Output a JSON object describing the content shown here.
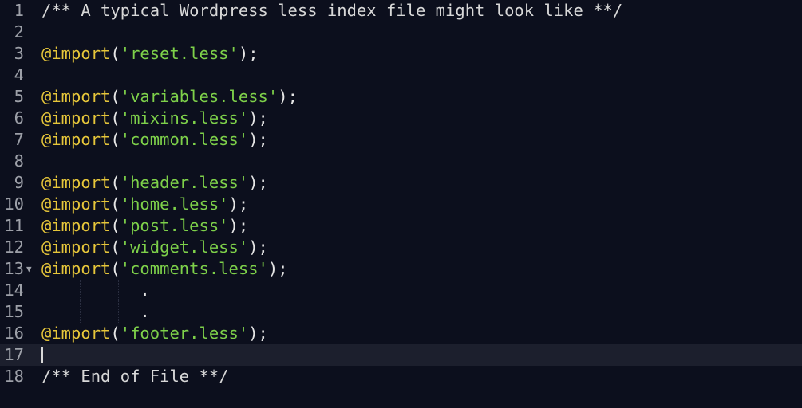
{
  "editor": {
    "lines": {
      "l1": {
        "num": "1",
        "text": "/** A typical Wordpress less index file might look like **/"
      },
      "l2": {
        "num": "2"
      },
      "l3": {
        "num": "3",
        "kw": "@import",
        "open": "(",
        "str": "'reset.less'",
        "close": ");"
      },
      "l4": {
        "num": "4"
      },
      "l5": {
        "num": "5",
        "kw": "@import",
        "open": "(",
        "str": "'variables.less'",
        "close": ");"
      },
      "l6": {
        "num": "6",
        "kw": "@import",
        "open": "(",
        "str": "'mixins.less'",
        "close": ");"
      },
      "l7": {
        "num": "7",
        "kw": "@import",
        "open": "(",
        "str": "'common.less'",
        "close": ");"
      },
      "l8": {
        "num": "8"
      },
      "l9": {
        "num": "9",
        "kw": "@import",
        "open": "(",
        "str": "'header.less'",
        "close": ");"
      },
      "l10": {
        "num": "10",
        "kw": "@import",
        "open": "(",
        "str": "'home.less'",
        "close": ");"
      },
      "l11": {
        "num": "11",
        "kw": "@import",
        "open": "(",
        "str": "'post.less'",
        "close": ");"
      },
      "l12": {
        "num": "12",
        "kw": "@import",
        "open": "(",
        "str": "'widget.less'",
        "close": ");"
      },
      "l13": {
        "num": "13",
        "fold": "▼",
        "kw": "@import",
        "open": "(",
        "str": "'comments.less'",
        "close": ");"
      },
      "l14": {
        "num": "14",
        "text": "          ."
      },
      "l15": {
        "num": "15",
        "text": "          ."
      },
      "l16": {
        "num": "16",
        "kw": "@import",
        "open": "(",
        "str": "'footer.less'",
        "close": ");"
      },
      "l17": {
        "num": "17"
      },
      "l18": {
        "num": "18",
        "text": "/** End of File **/"
      }
    },
    "current_line": "17",
    "colors": {
      "background": "#0c0f1d",
      "keyword": "#e6c63a",
      "string": "#7ed14a",
      "gutter": "#9da0a8",
      "current_line": "#1c1f2d"
    }
  }
}
